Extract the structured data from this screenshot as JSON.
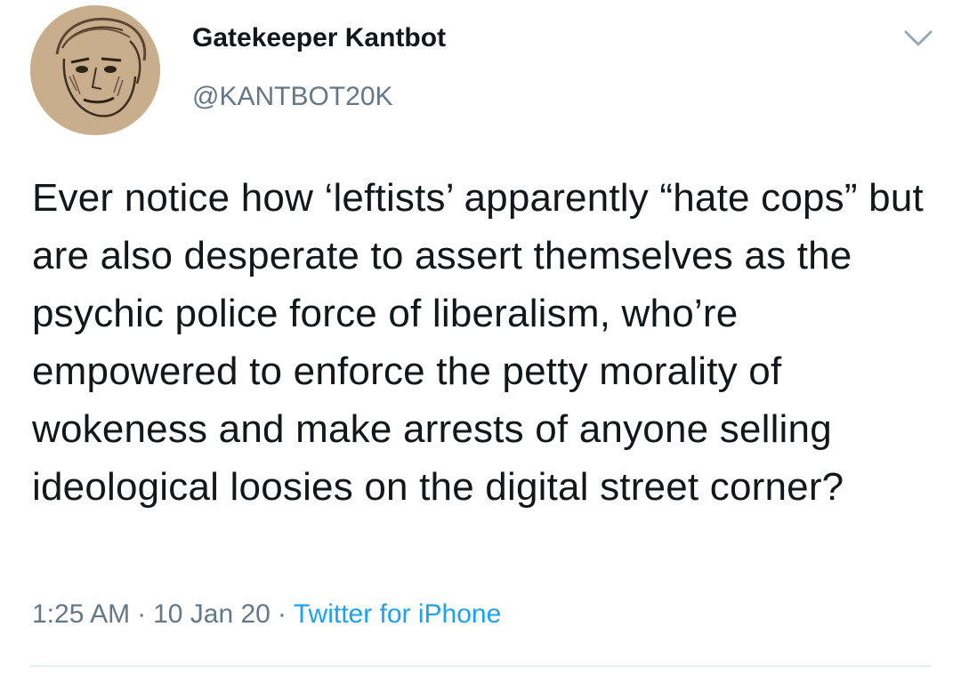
{
  "author": {
    "display_name": "Gatekeeper Kantbot",
    "handle": "@KANTBOT20K",
    "avatar_icon": "sketched-face-avatar"
  },
  "menu_icon": "chevron-down-icon",
  "tweet": {
    "text": "Ever notice how ‘leftists’ apparently “hate cops” but are also desperate to assert themselves as the psychic police force of liberalism, who’re empowered to enforce the petty morality of wokeness and make arrests of anyone selling ideological loosies on the digital street corner?"
  },
  "meta": {
    "time": "1:25 AM",
    "date": "10 Jan 20",
    "separator": "·",
    "source": "Twitter for iPhone"
  },
  "colors": {
    "text": "#14171a",
    "secondary": "#657786",
    "link": "#1da1f2",
    "divider": "#e6ecf0"
  }
}
